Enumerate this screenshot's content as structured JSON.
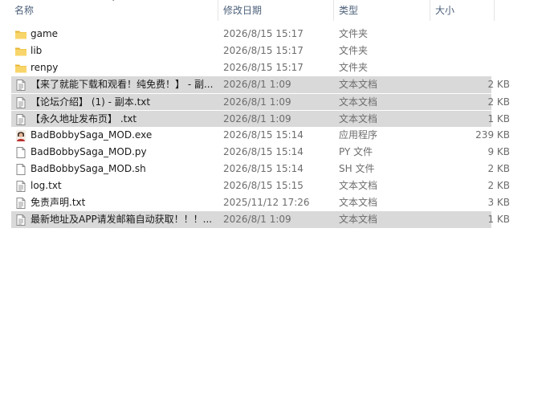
{
  "columns": {
    "name": "名称",
    "date": "修改日期",
    "type": "类型",
    "size": "大小"
  },
  "files": [
    {
      "name": "game",
      "date": "2026/8/15 15:17",
      "type": "文件夹",
      "size": "",
      "icon": "folder-icon",
      "selected": false
    },
    {
      "name": "lib",
      "date": "2026/8/15 15:17",
      "type": "文件夹",
      "size": "",
      "icon": "folder-icon",
      "selected": false
    },
    {
      "name": "renpy",
      "date": "2026/8/15 15:17",
      "type": "文件夹",
      "size": "",
      "icon": "folder-icon",
      "selected": false
    },
    {
      "name": "【来了就能下载和观看！纯免费！】 - 副...",
      "date": "2026/8/1 1:09",
      "type": "文本文档",
      "size": "2 KB",
      "icon": "text-file-icon",
      "selected": true
    },
    {
      "name": "【论坛介绍】 (1) - 副本.txt",
      "date": "2026/8/1 1:09",
      "type": "文本文档",
      "size": "2 KB",
      "icon": "text-file-icon",
      "selected": true
    },
    {
      "name": "【永久地址发布页】 .txt",
      "date": "2026/8/1 1:09",
      "type": "文本文档",
      "size": "1 KB",
      "icon": "text-file-icon",
      "selected": true
    },
    {
      "name": "BadBobbySaga_MOD.exe",
      "date": "2026/8/15 15:14",
      "type": "应用程序",
      "size": "239 KB",
      "icon": "app-avatar-icon",
      "selected": false
    },
    {
      "name": "BadBobbySaga_MOD.py",
      "date": "2026/8/15 15:14",
      "type": "PY 文件",
      "size": "9 KB",
      "icon": "blank-file-icon",
      "selected": false
    },
    {
      "name": "BadBobbySaga_MOD.sh",
      "date": "2026/8/15 15:14",
      "type": "SH 文件",
      "size": "2 KB",
      "icon": "blank-file-icon",
      "selected": false
    },
    {
      "name": "log.txt",
      "date": "2026/8/15 15:15",
      "type": "文本文档",
      "size": "2 KB",
      "icon": "text-file-icon",
      "selected": false
    },
    {
      "name": "免责声明.txt",
      "date": "2025/11/12 17:26",
      "type": "文本文档",
      "size": "3 KB",
      "icon": "text-file-icon",
      "selected": false
    },
    {
      "name": "最新地址及APP请发邮箱自动获取！！！...",
      "date": "2026/8/1 1:09",
      "type": "文本文档",
      "size": "1 KB",
      "icon": "text-file-icon",
      "selected": true
    }
  ],
  "colors": {
    "selection": "#d9d9d9",
    "folder": "#f8d56a",
    "header_text": "#4c607a"
  }
}
